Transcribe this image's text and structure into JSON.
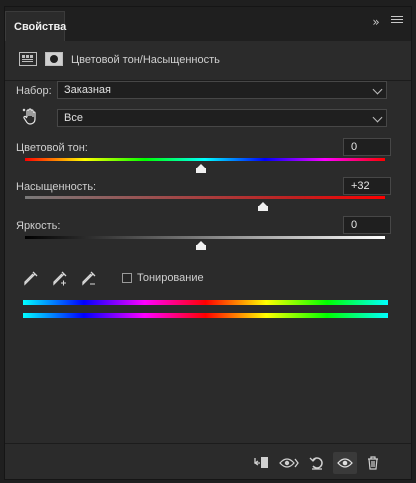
{
  "panel": {
    "tab_label": "Свойства",
    "collapse_glyph": "»",
    "title": "Цветовой тон/Насыщенность"
  },
  "preset": {
    "label": "Набор:",
    "value": "Заказная"
  },
  "channel": {
    "value": "Все"
  },
  "hue": {
    "label": "Цветовой тон:",
    "value": "0",
    "level_percent": 49
  },
  "saturation": {
    "label": "Насыщенность:",
    "value": "+32",
    "level_percent": 66
  },
  "lightness": {
    "label": "Яркость:",
    "value": "0",
    "level_percent": 49
  },
  "colorize": {
    "label": "Тонирование",
    "checked": false
  },
  "icons": {
    "tab_menu": "panel-menu-icon",
    "adjustment": "adjustment-layer-icon",
    "mask": "layer-mask-icon",
    "hand": "targeted-adjustment-hand-icon",
    "eyedropper": "eyedropper-icon",
    "eyedropper_add": "eyedropper-plus-icon",
    "eyedropper_sub": "eyedropper-minus-icon",
    "clip": "clip-to-layer-icon",
    "view_previous": "view-previous-state-icon",
    "reset": "reset-icon",
    "visibility": "visibility-eye-icon",
    "delete": "trash-icon"
  },
  "colors": {
    "panel_bg": "#2b2b2b",
    "field_bg": "#1f1f1f",
    "text": "#d6d6d6"
  }
}
